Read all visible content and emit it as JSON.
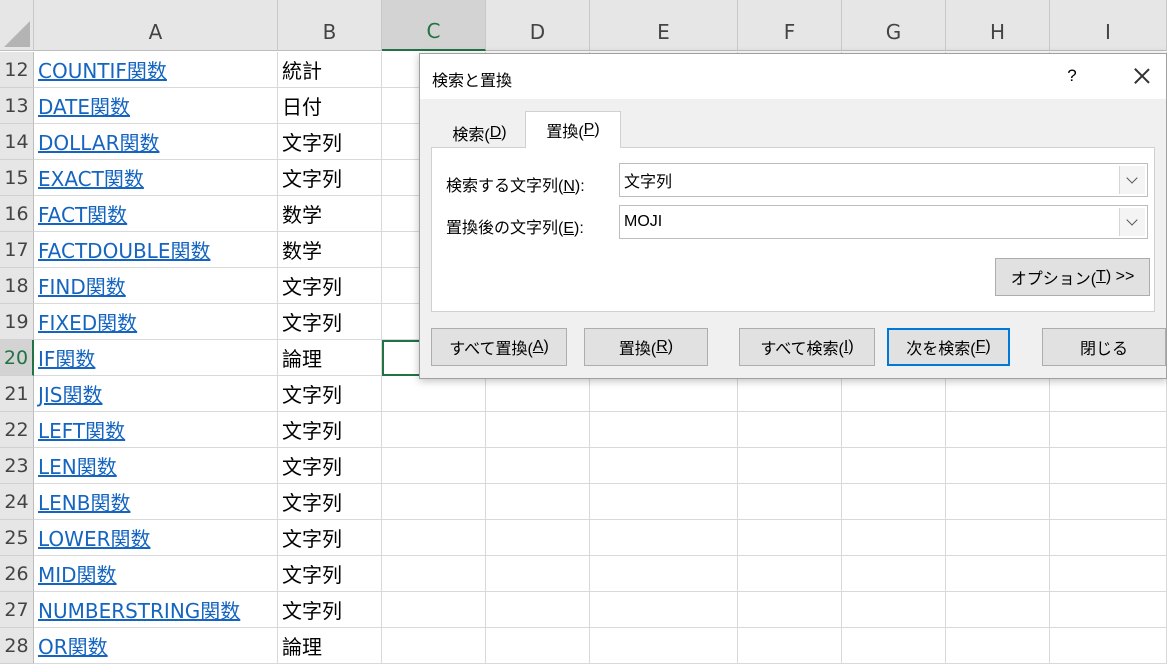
{
  "sheet": {
    "columns": [
      "A",
      "B",
      "C",
      "D",
      "E",
      "F",
      "G",
      "H",
      "I"
    ],
    "rows": [
      {
        "num": "12",
        "a": "COUNTIF関数",
        "b": "統計"
      },
      {
        "num": "13",
        "a": "DATE関数",
        "b": "日付"
      },
      {
        "num": "14",
        "a": "DOLLAR関数",
        "b": "文字列"
      },
      {
        "num": "15",
        "a": "EXACT関数",
        "b": "文字列"
      },
      {
        "num": "16",
        "a": "FACT関数",
        "b": "数学"
      },
      {
        "num": "17",
        "a": "FACTDOUBLE関数",
        "b": "数学"
      },
      {
        "num": "18",
        "a": "FIND関数",
        "b": "文字列"
      },
      {
        "num": "19",
        "a": "FIXED関数",
        "b": "文字列"
      },
      {
        "num": "20",
        "a": "IF関数",
        "b": "論理"
      },
      {
        "num": "21",
        "a": "JIS関数",
        "b": "文字列"
      },
      {
        "num": "22",
        "a": "LEFT関数",
        "b": "文字列"
      },
      {
        "num": "23",
        "a": "LEN関数",
        "b": "文字列"
      },
      {
        "num": "24",
        "a": "LENB関数",
        "b": "文字列"
      },
      {
        "num": "25",
        "a": "LOWER関数",
        "b": "文字列"
      },
      {
        "num": "26",
        "a": "MID関数",
        "b": "文字列"
      },
      {
        "num": "27",
        "a": "NUMBERSTRING関数",
        "b": "文字列"
      },
      {
        "num": "28",
        "a": "OR関数",
        "b": "論理"
      }
    ],
    "active_cell": "C20",
    "link_color": "#1565c0",
    "accent": "#217346"
  },
  "dialog": {
    "title": "検索と置換",
    "help": "?",
    "tabs": {
      "find": {
        "label": "検索(",
        "key": "D",
        "end": ")"
      },
      "replace": {
        "label": "置換(",
        "key": "P",
        "end": ")"
      }
    },
    "find_label": {
      "text": "検索する文字列(",
      "key": "N",
      "end": "):"
    },
    "replace_label": {
      "text": "置換後の文字列(",
      "key": "E",
      "end": "):"
    },
    "find_value": "文字列",
    "replace_value": "MOJI",
    "buttons": {
      "options": {
        "text": "オプション(",
        "key": "T",
        "end": ") >>"
      },
      "replace_all": {
        "text": "すべて置換(",
        "key": "A",
        "end": ")"
      },
      "replace": {
        "text": "置換(",
        "key": "R",
        "end": ")"
      },
      "find_all": {
        "text": "すべて検索(",
        "key": "I",
        "end": ")"
      },
      "find_next": {
        "text": "次を検索(",
        "key": "F",
        "end": ")"
      },
      "close": "閉じる"
    },
    "default_button_color": "#0078d7"
  }
}
